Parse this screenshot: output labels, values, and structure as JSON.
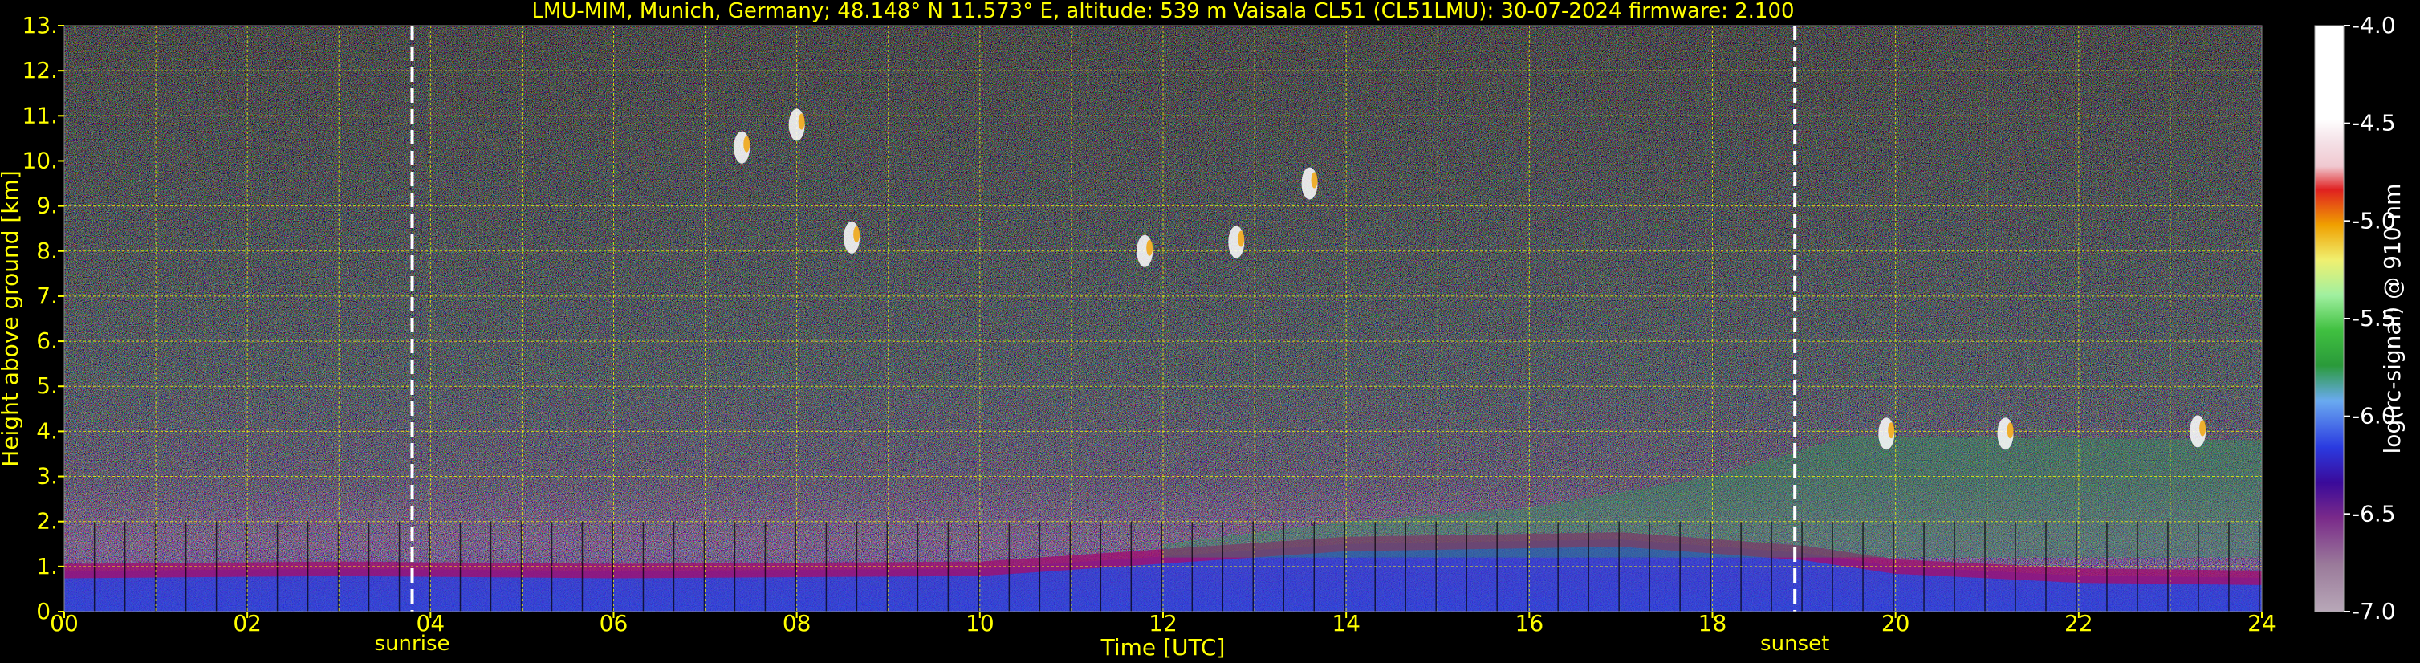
{
  "chart_data": {
    "type": "heatmap",
    "title": "LMU-MIM, Munich, Germany; 48.148° N 11.573° E, altitude: 539 m    Vaisala CL51 (CL51LMU): 30-07-2024    firmware: 2.100",
    "xlabel": "Time [UTC]",
    "ylabel": "Height above ground [km]",
    "xlim": [
      0,
      24
    ],
    "ylim": [
      0,
      13
    ],
    "x_ticks": [
      "00",
      "02",
      "04",
      "06",
      "08",
      "10",
      "12",
      "14",
      "16",
      "18",
      "20",
      "22",
      "24"
    ],
    "y_ticks": [
      "0.",
      "1.",
      "2.",
      "3.",
      "4.",
      "5.",
      "6.",
      "7.",
      "8.",
      "9.",
      "10.",
      "11.",
      "12.",
      "13."
    ],
    "grid": true,
    "colorbar": {
      "label": "log(rc-signal) @ 910 nm",
      "range": [
        -7.0,
        -4.0
      ],
      "ticks": [
        "-4.0",
        "-4.5",
        "-5.0",
        "-5.5",
        "-6.0",
        "-6.5",
        "-7.0"
      ]
    },
    "markers": [
      {
        "label": "sunrise",
        "time": 3.8
      },
      {
        "label": "sunset",
        "time": 18.9
      }
    ],
    "features": {
      "boundary_layer_top_km": [
        [
          0,
          0.9
        ],
        [
          3,
          0.95
        ],
        [
          6,
          0.9
        ],
        [
          10,
          0.95
        ],
        [
          14,
          1.5
        ],
        [
          17,
          1.6
        ],
        [
          19,
          1.3
        ],
        [
          20,
          1.0
        ],
        [
          22,
          0.8
        ],
        [
          24,
          0.75
        ]
      ],
      "residual_layer_top_km": [
        [
          12,
          1.5
        ],
        [
          14,
          2.0
        ],
        [
          16,
          2.3
        ],
        [
          18,
          3.0
        ],
        [
          19.5,
          3.9
        ],
        [
          24,
          3.8
        ]
      ],
      "cloud_patches": [
        {
          "time": 7.4,
          "height_km": 10.3
        },
        {
          "time": 8.0,
          "height_km": 10.8
        },
        {
          "time": 8.6,
          "height_km": 8.3
        },
        {
          "time": 11.8,
          "height_km": 8.0
        },
        {
          "time": 12.8,
          "height_km": 8.2
        },
        {
          "time": 13.6,
          "height_km": 9.5
        },
        {
          "time": 19.9,
          "height_km": 3.95
        },
        {
          "time": 21.2,
          "height_km": 3.95
        },
        {
          "time": 23.3,
          "height_km": 4.0
        }
      ]
    }
  }
}
